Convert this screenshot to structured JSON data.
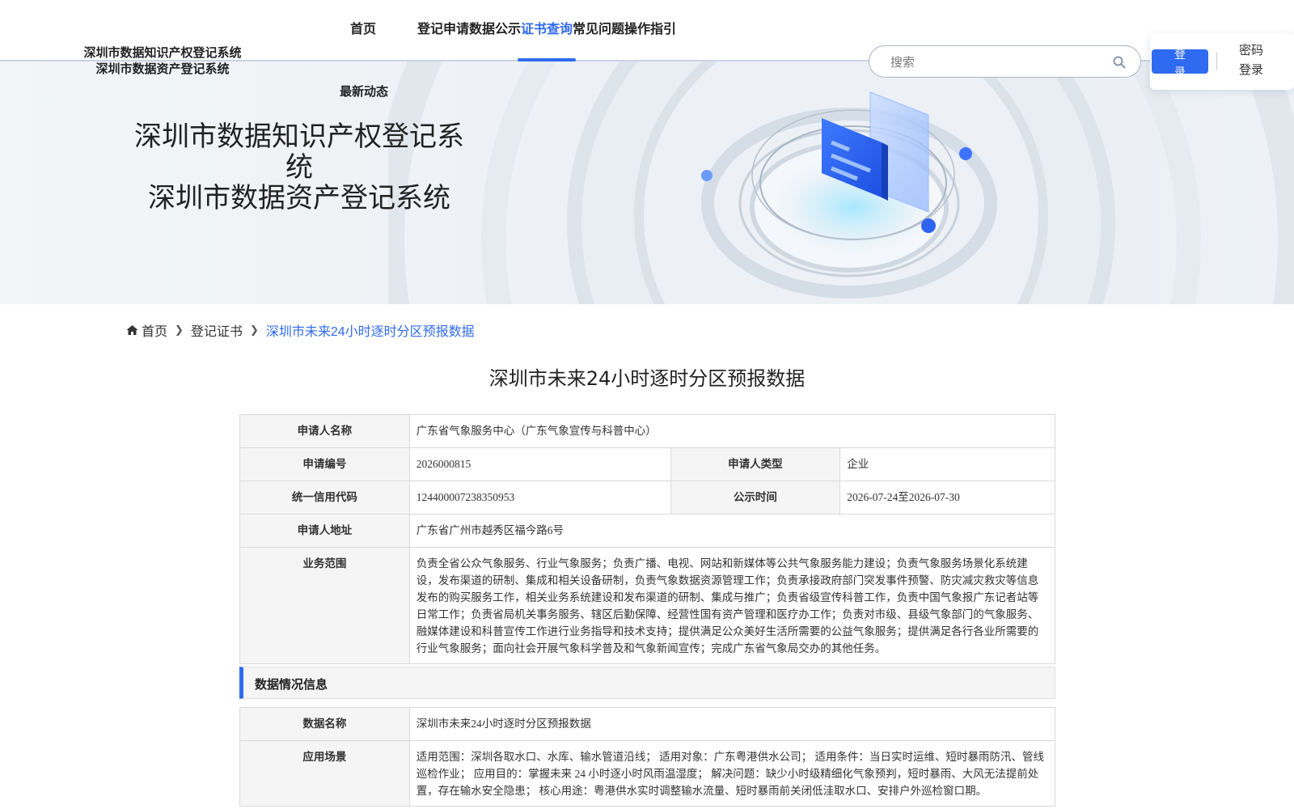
{
  "header": {
    "logo_line1": "深圳市数据知识产权登记系统",
    "logo_line2": "深圳市数据资产登记系统",
    "nav": [
      {
        "label": "首页",
        "active": false
      },
      {
        "label": "登记申请",
        "active": false
      },
      {
        "label": "数据公示",
        "active": false
      },
      {
        "label": "证书查询",
        "active": true
      },
      {
        "label": "常见问题",
        "active": false
      },
      {
        "label": "操作指引",
        "active": false
      }
    ],
    "nav_extra": "最新动态",
    "search_placeholder": "搜索",
    "login_label": "登录",
    "password_login_label": "密码登录"
  },
  "banner": {
    "title_line1": "深圳市数据知识产权登记系统",
    "title_line2": "深圳市数据资产登记系统"
  },
  "breadcrumb": {
    "home": "首页",
    "level1": "登记证书",
    "current": "深圳市未来24小时逐时分区预报数据"
  },
  "page_title": "深圳市未来24小时逐时分区预报数据",
  "applicant": {
    "name_label": "申请人名称",
    "name_value": "广东省气象服务中心（广东气象宣传与科普中心）",
    "number_label": "申请编号",
    "number_value": "2026000815",
    "type_label": "申请人类型",
    "type_value": "企业",
    "credit_code_label": "统一信用代码",
    "credit_code_value": "124400007238350953",
    "publicity_label": "公示时间",
    "publicity_value": "2026-07-24至2026-07-30",
    "address_label": "申请人地址",
    "address_value": "广东省广州市越秀区福今路6号",
    "scope_label": "业务范围",
    "scope_value": "负责全省公众气象服务、行业气象服务；负责广播、电视、网站和新媒体等公共气象服务能力建设；负责气象服务场景化系统建设，发布渠道的研制、集成和相关设备研制，负责气象数据资源管理工作；负责承接政府部门突发事件预警、防灾减灾救灾等信息发布的购买服务工作，相关业务系统建设和发布渠道的研制、集成与推广；负责省级宣传科普工作，负责中国气象报广东记者站等日常工作；负责省局机关事务服务、辖区后勤保障、经营性国有资产管理和医疗办工作；负责对市级、县级气象部门的气象服务、融媒体建设和科普宣传工作进行业务指导和技术支持；提供满足公众美好生活所需要的公益气象服务；提供满足各行各业所需要的行业气象服务；面向社会开展气象科学普及和气象新闻宣传；完成广东省气象局交办的其他任务。"
  },
  "data_section": {
    "heading": "数据情况信息",
    "data_name_label": "数据名称",
    "data_name_value": "深圳市未来24小时逐时分区预报数据",
    "scenario_label": "应用场景",
    "scenario_value": "适用范围：深圳各取水口、水库、输水管道沿线； 适用对象：广东粤港供水公司； 适用条件：当日实时运维、短时暴雨防汛、管线巡检作业； 应用目的：掌握未来 24 小时逐小时风雨温湿度； 解决问题：缺少小时级精细化气象预判，短时暴雨、大风无法提前处置，存在输水安全隐患； 核心用途：粤港供水实时调整输水流量、短时暴雨前关闭低洼取水口、安排户外巡检窗口期。"
  },
  "colors": {
    "accent": "#2f6bf0",
    "label_bg": "#f5f5f5",
    "border": "#d9d9d9"
  }
}
